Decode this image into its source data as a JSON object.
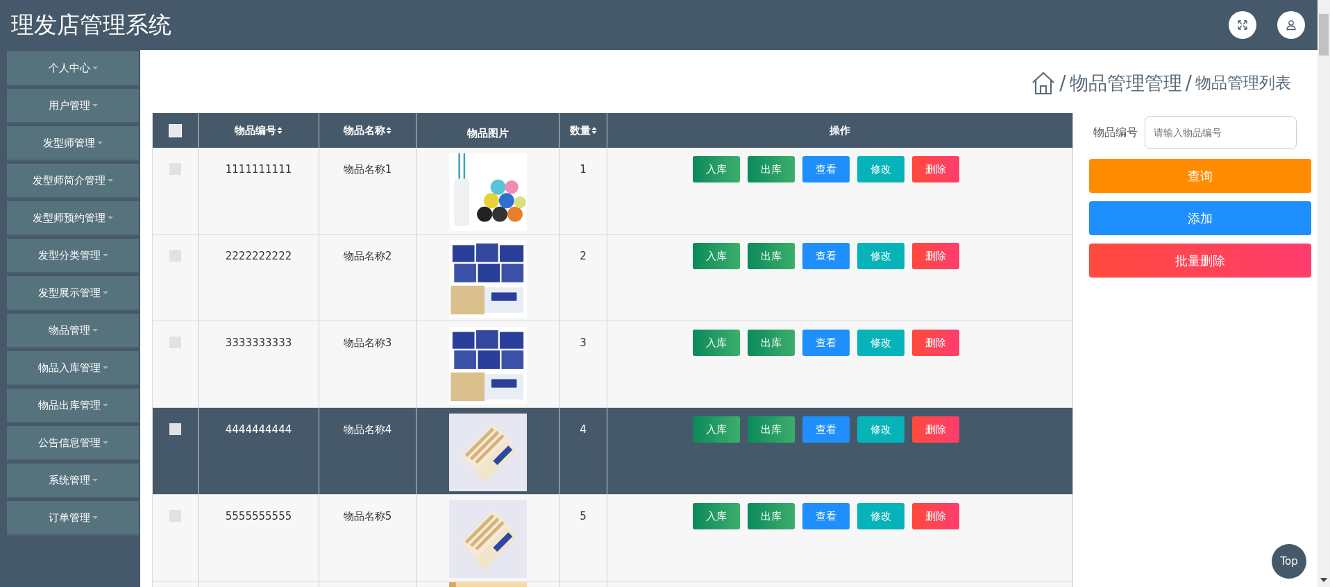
{
  "header": {
    "title": "理发店管理系统"
  },
  "sidebar": {
    "items": [
      {
        "label": "个人中心"
      },
      {
        "label": "用户管理"
      },
      {
        "label": "发型师管理"
      },
      {
        "label": "发型师简介管理"
      },
      {
        "label": "发型师预约管理"
      },
      {
        "label": "发型分类管理"
      },
      {
        "label": "发型展示管理"
      },
      {
        "label": "物品管理"
      },
      {
        "label": "物品入库管理"
      },
      {
        "label": "物品出库管理"
      },
      {
        "label": "公告信息管理"
      },
      {
        "label": "系统管理"
      },
      {
        "label": "订单管理"
      }
    ]
  },
  "breadcrumb": {
    "separator": "/",
    "section": "物品管理管理",
    "page": "物品管理列表"
  },
  "table": {
    "select_all": {
      "checked": false
    },
    "columns": [
      {
        "label": "物品编号",
        "sortable": true
      },
      {
        "label": "物品名称",
        "sortable": true
      },
      {
        "label": "物品图片",
        "sortable": false
      },
      {
        "label": "数量",
        "sortable": true
      },
      {
        "label": "操作",
        "sortable": false
      }
    ],
    "rows": [
      {
        "checked": false,
        "highlighted": false,
        "code": "1111111111",
        "name": "物品名称1",
        "quantity": "1",
        "actions": [
          {
            "label": "入库",
            "kind": "in"
          },
          {
            "label": "出库",
            "kind": "out"
          },
          {
            "label": "查看",
            "kind": "view"
          },
          {
            "label": "修改",
            "kind": "edit"
          },
          {
            "label": "删除",
            "kind": "delete"
          }
        ]
      },
      {
        "checked": false,
        "highlighted": false,
        "code": "2222222222",
        "name": "物品名称2",
        "quantity": "2",
        "actions": [
          {
            "label": "入库",
            "kind": "in"
          },
          {
            "label": "出库",
            "kind": "out"
          },
          {
            "label": "查看",
            "kind": "view"
          },
          {
            "label": "修改",
            "kind": "edit"
          },
          {
            "label": "删除",
            "kind": "delete"
          }
        ]
      },
      {
        "checked": false,
        "highlighted": false,
        "code": "3333333333",
        "name": "物品名称3",
        "quantity": "3",
        "actions": [
          {
            "label": "入库",
            "kind": "in"
          },
          {
            "label": "出库",
            "kind": "out"
          },
          {
            "label": "查看",
            "kind": "view"
          },
          {
            "label": "修改",
            "kind": "edit"
          },
          {
            "label": "删除",
            "kind": "delete"
          }
        ]
      },
      {
        "checked": false,
        "highlighted": true,
        "code": "4444444444",
        "name": "物品名称4",
        "quantity": "4",
        "actions": [
          {
            "label": "入库",
            "kind": "in"
          },
          {
            "label": "出库",
            "kind": "out"
          },
          {
            "label": "查看",
            "kind": "view"
          },
          {
            "label": "修改",
            "kind": "edit"
          },
          {
            "label": "删除",
            "kind": "delete"
          }
        ]
      },
      {
        "checked": false,
        "highlighted": false,
        "code": "5555555555",
        "name": "物品名称5",
        "quantity": "5",
        "actions": [
          {
            "label": "入库",
            "kind": "in"
          },
          {
            "label": "出库",
            "kind": "out"
          },
          {
            "label": "查看",
            "kind": "view"
          },
          {
            "label": "修改",
            "kind": "edit"
          },
          {
            "label": "删除",
            "kind": "delete"
          }
        ]
      },
      {
        "kind": "picture"
      }
    ]
  },
  "search": {
    "label": "物品编号",
    "placeholder": "请输入物品编号"
  },
  "buttons": [
    {
      "label": "查询",
      "kind": "search"
    },
    {
      "label": "添加",
      "kind": "add"
    },
    {
      "label": "批量删除",
      "kind": "batch-delete"
    }
  ],
  "back_to_top": {
    "label": "Top"
  }
}
